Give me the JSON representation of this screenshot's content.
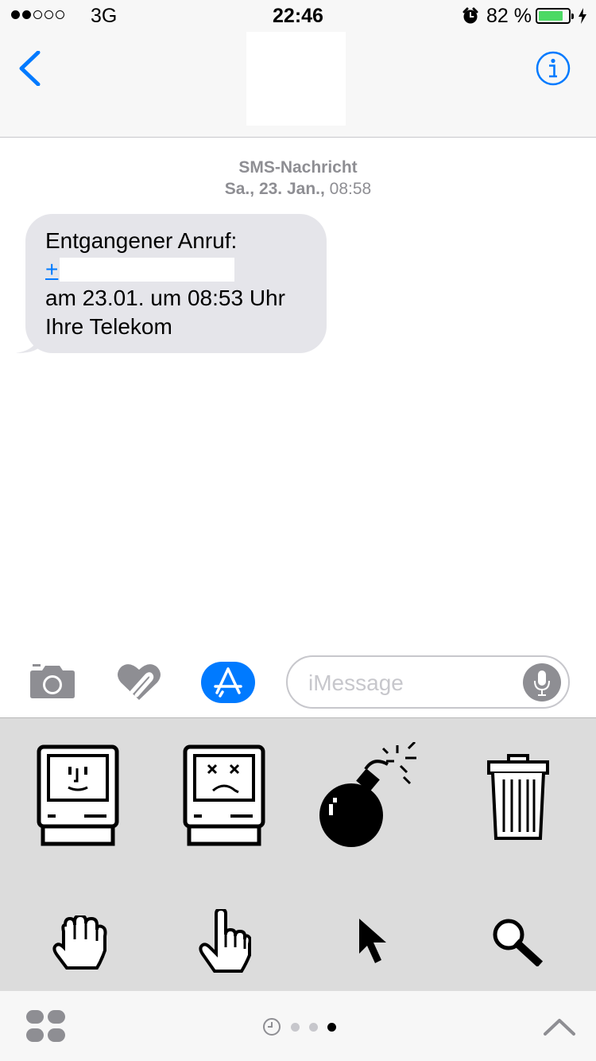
{
  "status_bar": {
    "signal_bars_filled": 2,
    "signal_bars_total": 5,
    "carrier": "3G",
    "time": "22:46",
    "battery_percent": "82 %",
    "battery_level": 0.82,
    "alarm_icon": "alarm-clock-icon",
    "charging_icon": "bolt-icon"
  },
  "nav": {
    "back_icon": "chevron-left-icon",
    "info_icon": "info-icon"
  },
  "conversation": {
    "service_label": "SMS-Nachricht",
    "date_label": "Sa., 23. Jan.,",
    "time_label": "08:58",
    "message": {
      "line1": "Entgangener Anruf:",
      "phone_prefix": "+",
      "line3": "am 23.01. um 08:53 Uhr",
      "line4": "Ihre Telekom"
    }
  },
  "compose": {
    "placeholder": "iMessage",
    "camera_icon": "camera-icon",
    "digital_touch_icon": "heart-touch-icon",
    "app_store_icon": "app-store-icon",
    "mic_icon": "microphone-icon"
  },
  "sticker_drawer": {
    "stickers": [
      "happy-mac-icon",
      "sad-mac-icon",
      "bomb-icon",
      "trash-can-icon",
      "grab-hand-icon",
      "pointing-hand-icon",
      "arrow-cursor-icon",
      "magnifier-icon"
    ]
  },
  "bottom_bar": {
    "apps_icon": "app-drawer-icon",
    "recents_icon": "clock-icon",
    "page_count": 3,
    "active_page": 3,
    "expand_icon": "chevron-up-icon"
  },
  "colors": {
    "accent": "#007aff",
    "bubble": "#e5e5ea",
    "battery": "#4cd964",
    "drawer": "#dcdcdc"
  }
}
